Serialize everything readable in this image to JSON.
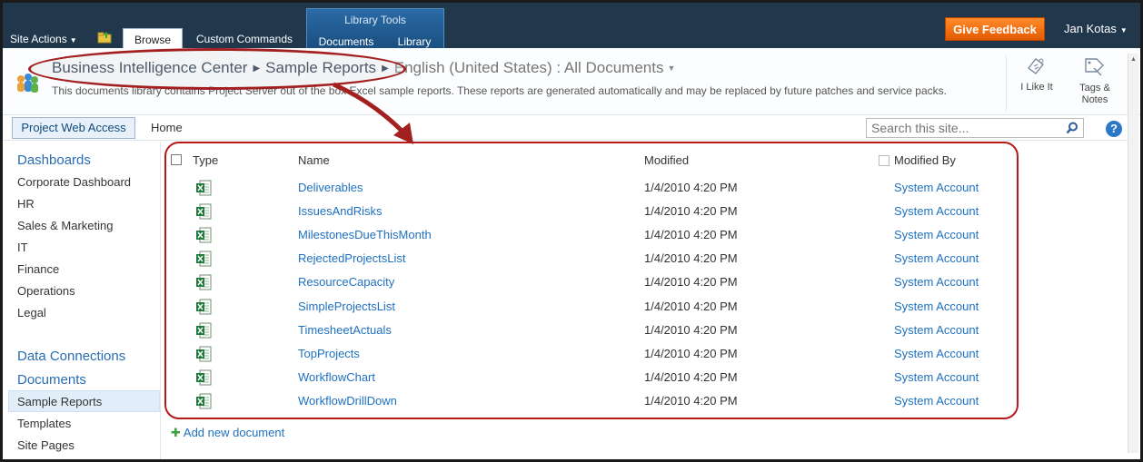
{
  "ribbon": {
    "site_actions": "Site Actions",
    "tabs": {
      "browse": "Browse",
      "custom": "Custom Commands",
      "documents": "Documents",
      "library": "Library"
    },
    "library_tools": "Library Tools",
    "feedback": "Give Feedback",
    "user": "Jan Kotas"
  },
  "title": {
    "crumb1": "Business Intelligence Center",
    "crumb2": "Sample Reports",
    "crumb3": "English (United States) : All Documents",
    "description": "This documents library contains Project Server out of the box Excel sample reports. These reports are generated automatically and may be replaced by future patches and service packs.",
    "ilike": "I Like It",
    "tags": "Tags & Notes"
  },
  "topnav": {
    "pwa": "Project Web Access",
    "home": "Home",
    "search_placeholder": "Search this site...",
    "help": "?"
  },
  "leftnav": {
    "dashboards": "Dashboards",
    "dash_items": [
      "Corporate Dashboard",
      "HR",
      "Sales & Marketing",
      "IT",
      "Finance",
      "Operations",
      "Legal"
    ],
    "data_connections": "Data Connections",
    "documents": "Documents",
    "doc_items": [
      "Sample Reports",
      "Templates",
      "Site Pages"
    ]
  },
  "list": {
    "headers": {
      "type": "Type",
      "name": "Name",
      "modified": "Modified",
      "modified_by": "Modified By"
    },
    "rows": [
      {
        "name": "Deliverables",
        "modified": "1/4/2010 4:20 PM",
        "by": "System Account"
      },
      {
        "name": "IssuesAndRisks",
        "modified": "1/4/2010 4:20 PM",
        "by": "System Account"
      },
      {
        "name": "MilestonesDueThisMonth",
        "modified": "1/4/2010 4:20 PM",
        "by": "System Account"
      },
      {
        "name": "RejectedProjectsList",
        "modified": "1/4/2010 4:20 PM",
        "by": "System Account"
      },
      {
        "name": "ResourceCapacity",
        "modified": "1/4/2010 4:20 PM",
        "by": "System Account"
      },
      {
        "name": "SimpleProjectsList",
        "modified": "1/4/2010 4:20 PM",
        "by": "System Account"
      },
      {
        "name": "TimesheetActuals",
        "modified": "1/4/2010 4:20 PM",
        "by": "System Account"
      },
      {
        "name": "TopProjects",
        "modified": "1/4/2010 4:20 PM",
        "by": "System Account"
      },
      {
        "name": "WorkflowChart",
        "modified": "1/4/2010 4:20 PM",
        "by": "System Account"
      },
      {
        "name": "WorkflowDrillDown",
        "modified": "1/4/2010 4:20 PM",
        "by": "System Account"
      }
    ],
    "add_new": "Add new document"
  },
  "colors": {
    "ribbon": "#21374c",
    "link": "#1e70c0",
    "feedback": "#f07010",
    "highlight": "#b71818"
  }
}
